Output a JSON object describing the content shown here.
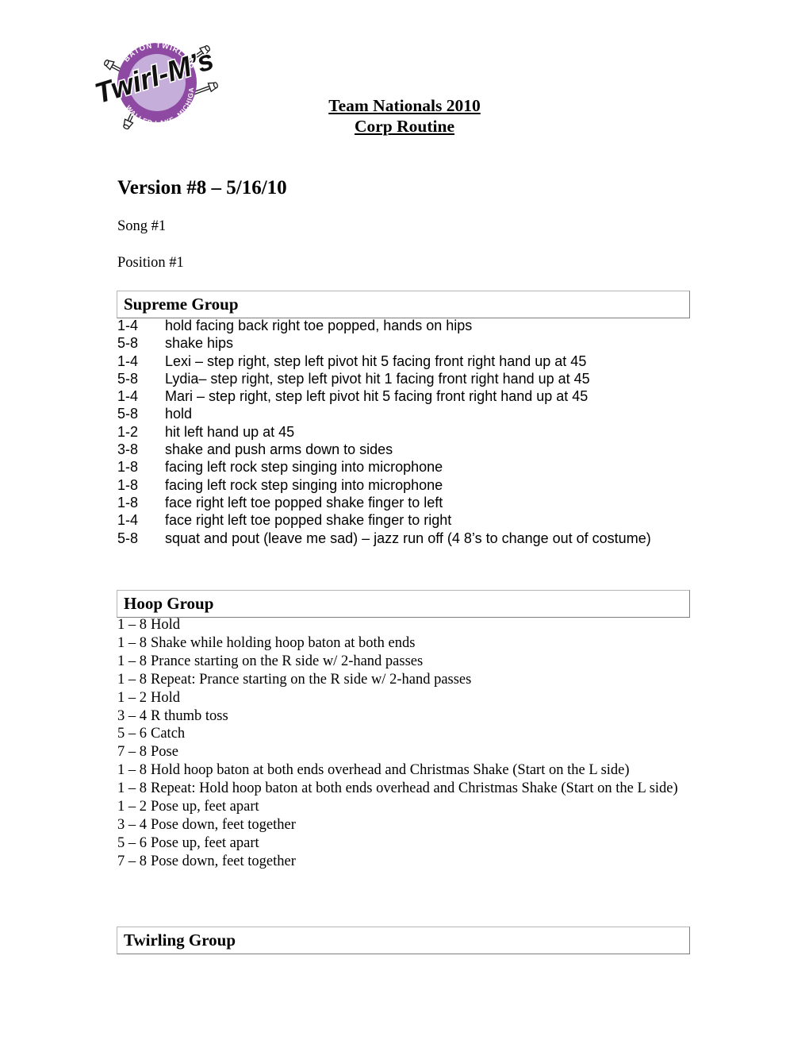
{
  "logo": {
    "name": "twirl-ms-logo",
    "brand_text": "Twirl-M's",
    "arc_top_text": "BATON TWIRLING",
    "arc_bottom_text": "WALLED LAKE, MICHIGAN",
    "colors": {
      "ring_purple": "#8E4AA3",
      "inner_purple": "#C6AEDA",
      "brand_black": "#101010",
      "baton_white": "#FFFFFF"
    }
  },
  "header": {
    "line1": "Team Nationals 2010",
    "line2": "Corp Routine"
  },
  "document": {
    "version": "Version #8 – 5/16/10",
    "song": "Song #1",
    "position": "Position #1"
  },
  "sections": [
    {
      "title": "Supreme Group",
      "font": "sans",
      "rows": [
        {
          "cue": "1-4",
          "text": "hold facing back right toe popped, hands on hips"
        },
        {
          "cue": "5-8",
          "text": "shake hips"
        },
        {
          "cue": "1-4",
          "text": "Lexi – step right, step left pivot hit 5 facing front right hand up at 45"
        },
        {
          "cue": "5-8",
          "text": "Lydia– step right, step left pivot hit 1 facing front right hand up at 45"
        },
        {
          "cue": "1-4",
          "text": "Mari – step right, step left pivot hit 5 facing front right hand up at 45"
        },
        {
          "cue": "5-8",
          "text": "hold"
        },
        {
          "cue": "1-2",
          "text": "hit left hand up at 45"
        },
        {
          "cue": "3-8",
          "text": "shake and push arms down to sides"
        },
        {
          "cue": "1-8",
          "text": "facing left rock step singing into microphone"
        },
        {
          "cue": "1-8",
          "text": "facing left rock step singing into microphone"
        },
        {
          "cue": "1-8",
          "text": "face right left toe popped shake finger to left"
        },
        {
          "cue": "1-4",
          "text": "face right left toe popped shake finger to right"
        },
        {
          "cue": "5-8",
          "text": "squat and pout (leave me sad) – jazz run off (4 8’s to change out of costume)"
        }
      ]
    },
    {
      "title": "Hoop Group",
      "font": "serif",
      "rows": [
        {
          "cue": "1 – 8",
          "text": "Hold"
        },
        {
          "cue": "1 – 8",
          "text": "Shake while holding hoop baton at both ends"
        },
        {
          "cue": "1 – 8",
          "text": "Prance starting on the R side w/ 2-hand passes"
        },
        {
          "cue": "1 – 8",
          "text": "Repeat: Prance starting on the R side w/ 2-hand passes"
        },
        {
          "cue": "1 – 2",
          "text": "Hold"
        },
        {
          "cue": "3 – 4",
          "text": "R thumb toss"
        },
        {
          "cue": "5 – 6",
          "text": "Catch"
        },
        {
          "cue": "7 – 8",
          "text": "Pose"
        },
        {
          "cue": "1 – 8",
          "text": "Hold hoop baton at both ends overhead and Christmas Shake (Start on the L side)"
        },
        {
          "cue": "1 – 8",
          "text": "Repeat: Hold hoop baton at both ends overhead and Christmas Shake (Start on the L side)"
        },
        {
          "cue": "1 – 2",
          "text": "Pose up, feet apart"
        },
        {
          "cue": "3 – 4",
          "text": "Pose down, feet together"
        },
        {
          "cue": "5 – 6",
          "text": "Pose up, feet apart"
        },
        {
          "cue": "7 – 8",
          "text": "Pose down, feet together"
        }
      ]
    },
    {
      "title": "Twirling Group",
      "font": "serif",
      "rows": []
    }
  ]
}
